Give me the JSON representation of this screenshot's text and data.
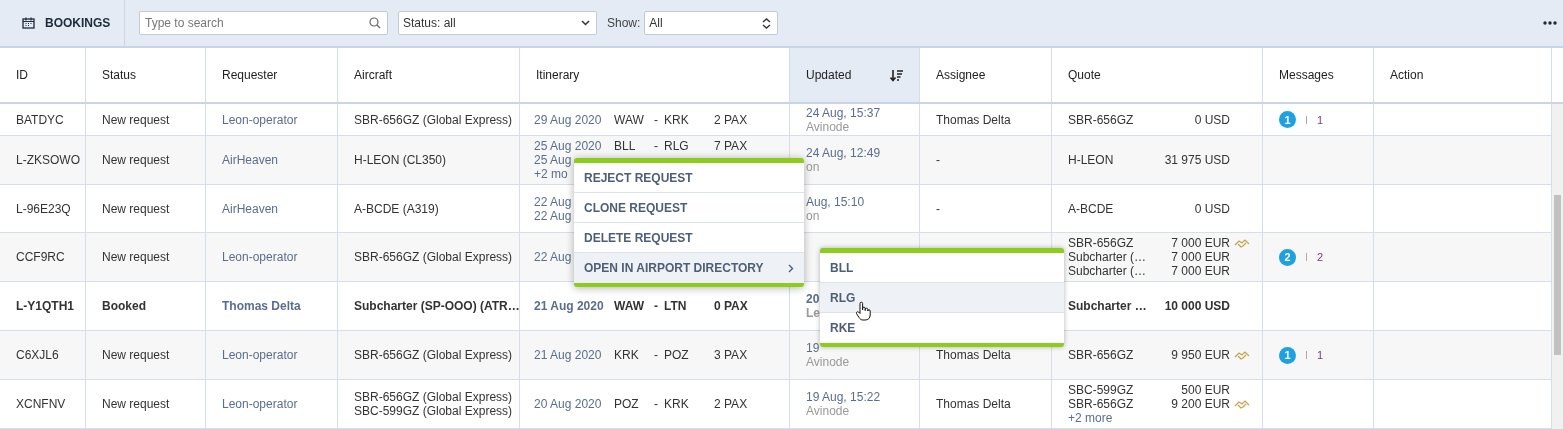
{
  "toolbar": {
    "title": "BOOKINGS",
    "search": {
      "placeholder": "Type to search"
    },
    "status_filter": {
      "value": "Status: all"
    },
    "show_label": "Show:",
    "show_filter": {
      "value": "All"
    }
  },
  "table": {
    "columns": [
      {
        "label": "ID",
        "sorted": false
      },
      {
        "label": "Status",
        "sorted": false
      },
      {
        "label": "Requester",
        "sorted": false
      },
      {
        "label": "Aircraft",
        "sorted": false
      },
      {
        "label": "Itinerary",
        "sorted": false
      },
      {
        "label": "Updated",
        "sorted": true
      },
      {
        "label": "Assignee",
        "sorted": false
      },
      {
        "label": "Quote",
        "sorted": false
      },
      {
        "label": "Messages",
        "sorted": false
      },
      {
        "label": "Action",
        "sorted": false
      }
    ],
    "rows": [
      {
        "id": "BATDYC",
        "status": "New request",
        "requester": "Leon-operator",
        "aircraft": [
          "SBR-656GZ (Global Express)"
        ],
        "itinerary": [
          {
            "date": "29 Aug 2020",
            "from": "WAW",
            "sep": "-",
            "to": "KRK",
            "pax": "2 PAX"
          }
        ],
        "updated": [
          "24 Aug, 15:37",
          "Avinode"
        ],
        "assignee": "Thomas Delta",
        "quote": [
          {
            "name": "SBR-656GZ",
            "price": "0 USD",
            "handshake": false
          }
        ],
        "messages": {
          "badge": "1",
          "count": "1"
        },
        "bold": false
      },
      {
        "id": "L-ZKSOWO",
        "status": "New request",
        "requester": "AirHeaven",
        "aircraft": [
          "H-LEON (CL350)"
        ],
        "itinerary": [
          {
            "date": "25 Aug 2020",
            "from": "BLL",
            "sep": "-",
            "to": "RLG",
            "pax": "7 PAX"
          },
          {
            "date": "25 Aug"
          }
        ],
        "itinerary_more": "+2 mo",
        "updated": [
          "24 Aug, 12:49",
          "on"
        ],
        "assignee": "-",
        "quote": [
          {
            "name": "H-LEON",
            "price": "31 975 USD",
            "handshake": false
          }
        ],
        "bold": false
      },
      {
        "id": "L-96E23Q",
        "status": "New request",
        "requester": "AirHeaven",
        "aircraft": [
          "A-BCDE (A319)"
        ],
        "itinerary": [
          {
            "date": "22 Aug"
          },
          {
            "date": "22 Aug"
          }
        ],
        "updated": [
          "Aug, 15:10",
          "on"
        ],
        "assignee": "-",
        "quote": [
          {
            "name": "A-BCDE",
            "price": "0 USD",
            "handshake": false
          }
        ],
        "bold": false
      },
      {
        "id": "CCF9RC",
        "status": "New request",
        "requester": "Leon-operator",
        "aircraft": [
          "SBR-656GZ (Global Express)"
        ],
        "itinerary": [
          {
            "date": "22 Aug"
          }
        ],
        "quote": [
          {
            "name": "SBR-656GZ",
            "price": "7 000 EUR",
            "handshake": true
          },
          {
            "name": "Subcharter (…",
            "price": "7 000 EUR",
            "handshake": false
          },
          {
            "name": "Subcharter (…",
            "price": "7 000 EUR",
            "handshake": false
          }
        ],
        "messages": {
          "badge": "2",
          "count": "2"
        },
        "bold": false
      },
      {
        "id": "L-Y1QTH1",
        "status": "Booked",
        "requester": "Thomas Delta",
        "aircraft": [
          "Subcharter (SP-OOO) (ATR…"
        ],
        "itinerary": [
          {
            "date": "21 Aug 2020",
            "from": "WAW",
            "sep": "-",
            "to": "LTN",
            "pax": "0 PAX"
          }
        ],
        "updated": [
          "20",
          "Le"
        ],
        "quote": [
          {
            "name": "Subcharter …",
            "price": "10 000 USD",
            "handshake": false
          }
        ],
        "bold": true
      },
      {
        "id": "C6XJL6",
        "status": "New request",
        "requester": "Leon-operator",
        "aircraft": [
          "SBR-656GZ (Global Express)"
        ],
        "itinerary": [
          {
            "date": "21 Aug 2020",
            "from": "KRK",
            "sep": "-",
            "to": "POZ",
            "pax": "3 PAX"
          }
        ],
        "updated": [
          "19",
          "Avinode"
        ],
        "assignee": "Thomas Delta",
        "quote": [
          {
            "name": "SBR-656GZ",
            "price": "9 950 EUR",
            "handshake": true
          }
        ],
        "messages": {
          "badge": "1",
          "count": "1"
        },
        "bold": false
      },
      {
        "id": "XCNFNV",
        "status": "New request",
        "requester": "Leon-operator",
        "aircraft": [
          "SBR-656GZ (Global Express)",
          "SBC-599GZ (Global Express)"
        ],
        "itinerary": [
          {
            "date": "20 Aug 2020",
            "from": "POZ",
            "sep": "-",
            "to": "KRK",
            "pax": "2 PAX"
          }
        ],
        "updated": [
          "19 Aug, 15:22",
          "Avinode"
        ],
        "assignee": "Thomas Delta",
        "quote": [
          {
            "name": "SBC-599GZ",
            "price": "500 EUR",
            "handshake": false
          },
          {
            "name": "SBR-656GZ",
            "price": "9 200 EUR",
            "handshake": true
          }
        ],
        "quote_more": "+2 more",
        "bold": false
      }
    ]
  },
  "context_menu": {
    "items": [
      {
        "label": "REJECT REQUEST",
        "selected": false,
        "submenu": false
      },
      {
        "label": "CLONE REQUEST",
        "selected": false,
        "submenu": false
      },
      {
        "label": "DELETE REQUEST",
        "selected": false,
        "submenu": false
      },
      {
        "label": "OPEN IN AIRPORT DIRECTORY",
        "selected": true,
        "submenu": true
      }
    ]
  },
  "submenu": {
    "items": [
      {
        "label": "BLL",
        "selected": false
      },
      {
        "label": "RLG",
        "selected": true
      },
      {
        "label": "RKE",
        "selected": false
      }
    ]
  }
}
